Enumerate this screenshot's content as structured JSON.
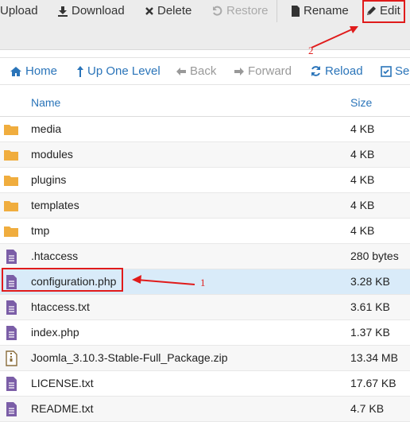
{
  "toolbar": {
    "upload": "Upload",
    "download": "Download",
    "delete": "Delete",
    "restore": "Restore",
    "rename": "Rename",
    "edit": "Edit"
  },
  "nav": {
    "home": "Home",
    "up_one_level": "Up One Level",
    "back": "Back",
    "forward": "Forward",
    "reload": "Reload",
    "select_all": "Sele"
  },
  "table": {
    "headers": {
      "name": "Name",
      "size": "Size"
    },
    "rows": [
      {
        "name": "media",
        "size": "4 KB",
        "icon": "folder-icon"
      },
      {
        "name": "modules",
        "size": "4 KB",
        "icon": "folder-icon"
      },
      {
        "name": "plugins",
        "size": "4 KB",
        "icon": "folder-icon"
      },
      {
        "name": "templates",
        "size": "4 KB",
        "icon": "folder-icon"
      },
      {
        "name": "tmp",
        "size": "4 KB",
        "icon": "folder-icon"
      },
      {
        "name": ".htaccess",
        "size": "280 bytes",
        "icon": "text-file-icon"
      },
      {
        "name": "configuration.php",
        "size": "3.28 KB",
        "icon": "text-file-icon",
        "selected": true
      },
      {
        "name": "htaccess.txt",
        "size": "3.61 KB",
        "icon": "text-file-icon"
      },
      {
        "name": "index.php",
        "size": "1.37 KB",
        "icon": "text-file-icon"
      },
      {
        "name": "Joomla_3.10.3-Stable-Full_Package.zip",
        "size": "13.34 MB",
        "icon": "zip-file-icon"
      },
      {
        "name": "LICENSE.txt",
        "size": "17.67 KB",
        "icon": "text-file-icon"
      },
      {
        "name": "README.txt",
        "size": "4.7 KB",
        "icon": "text-file-icon"
      }
    ]
  },
  "annotations": {
    "step1": "1",
    "step2": "2"
  },
  "colors": {
    "accent": "#2a74b9",
    "folder": "#f0ad3e",
    "file": "#7b5ea7",
    "annotation": "#e01b1b",
    "selected": "#d9ebf9"
  }
}
